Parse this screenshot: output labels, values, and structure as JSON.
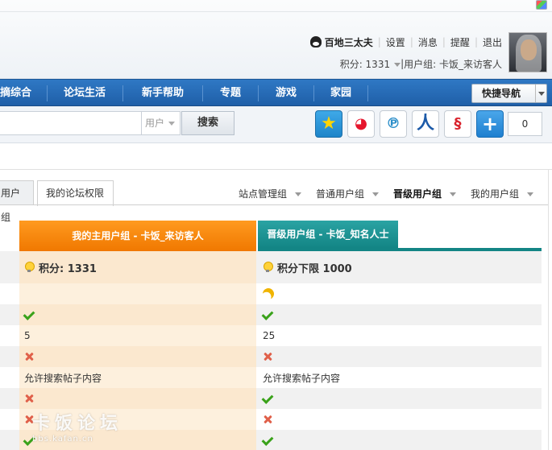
{
  "header": {
    "username": "百地三太夫",
    "links": [
      "设置",
      "消息",
      "提醒",
      "退出"
    ],
    "points": "积分: 1331",
    "user_group": "用户组: 卡饭_来访客人"
  },
  "nav": {
    "items": [
      "摘综合",
      "论坛生活",
      "新手帮助",
      "专题",
      "游戏",
      "家园"
    ],
    "quick_nav": "快捷导航"
  },
  "search": {
    "type": "用户",
    "button": "搜索",
    "share_count": "0"
  },
  "tabs": {
    "items": [
      "用户组",
      "我的论坛权限"
    ],
    "group_links": [
      "站点管理组",
      "普通用户组",
      "晋级用户组",
      "我的用户组"
    ]
  },
  "comparison": {
    "col_a_title": "我的主用户组 - 卡饭_来访客人",
    "col_b_title": "晋级用户组 - 卡饭_知名人士",
    "points_a": "积分: 1331",
    "points_b": "积分下限 1000",
    "value_a": "5",
    "value_b": "25",
    "search_a": "允许搜索帖子内容",
    "search_b": "允许搜索帖子内容"
  },
  "watermark": {
    "name": "卡饭论坛",
    "url": "bbs.kafan.cn"
  },
  "colors": {
    "nav_blue": "#2f78c4",
    "orange": "#f07800",
    "teal": "#138585",
    "check_green": "#3aa21a",
    "cross_red": "#e0604a"
  }
}
